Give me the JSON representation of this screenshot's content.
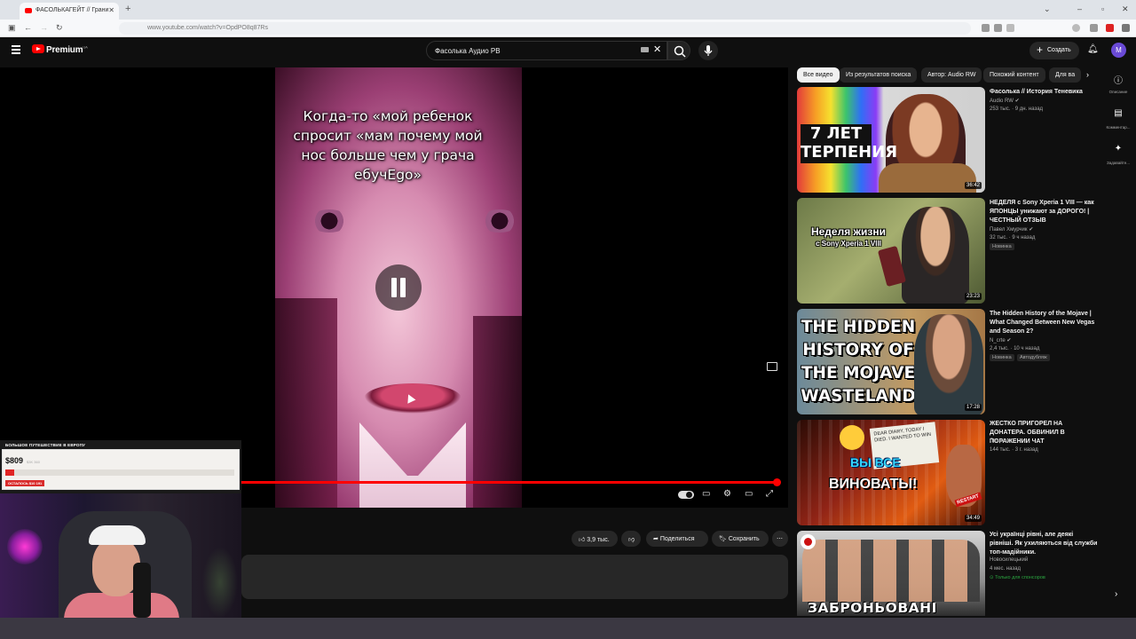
{
  "browser": {
    "tab_title": "ФАСОЛЬКАГЕЙТ // Грани",
    "url": "www.youtube.com/watch?v=OpdPO8q87Rs"
  },
  "header": {
    "logo": "Premium",
    "region": "UA",
    "search_value": "Фасолька Аудио РВ",
    "create_label": "Создать",
    "avatar_letter": "M"
  },
  "player": {
    "caption_lines": [
      "Когда-то «мой ребенок",
      "спросит «мам почему мой",
      "нос больше чем у грача",
      "ебучEgo»"
    ],
    "progress_percent": 99
  },
  "actions": {
    "likes": "3,9 тыс.",
    "share": "Поделиться",
    "save": "Сохранить"
  },
  "overlay": {
    "goal_title": "БОЛЬШОЕ ПУТЕШЕСТВИЕ В ЕВРОПУ",
    "goal_amount": "$809",
    "goal_target": "$3K 360",
    "goal_note": "ОСТАЛОСЬ $10 191",
    "goal_percent": 4
  },
  "chips": [
    "Все видео",
    "Из результатов поиска",
    "Автор: Audio RW",
    "Похожий контент",
    "Для ва"
  ],
  "side_panel": [
    {
      "icon": "info-icon",
      "label": "Описание"
    },
    {
      "icon": "comments-icon",
      "label": "Комментар..."
    },
    {
      "icon": "sparkle-icon",
      "label": "Задавайте..."
    }
  ],
  "videos": [
    {
      "title": "Фасолька // История Теневика",
      "channel": "Audio RW",
      "meta": "253 тыс. · 9 дн. назад",
      "duration": "36:42",
      "thumb_text": "7 ЛЕТ ТЕРПЕНИЯ"
    },
    {
      "title": "НЕДЕЛЯ с Sony Xperia 1 VIII — как ЯПОНЦЫ унижают за ДОРОГО! | ЧЕСТНЫЙ ОТЗЫВ",
      "channel": "Павел Хмурчик",
      "meta": "32 тыс. · 9 ч назад",
      "badge": "Новинка",
      "duration": "23:23",
      "thumb_text": "Неделя жизни",
      "thumb_text2": "с Sony Xperia 1 VIII"
    },
    {
      "title": "The Hidden History of the Mojave | What Changed Between New Vegas and Season 2?",
      "channel": "N_crte",
      "meta": "2,4 тыс. · 10 ч назад",
      "badge": "Новинка",
      "badge2": "Автодубляж",
      "duration": "17:28",
      "thumb_text": "THE HIDDEN HISTORY OF THE MOJAVE WASTELAND"
    },
    {
      "title": "ЖЕСТКО ПРИГОРЕЛ НА ДОНАТЕРА. ОБВИНИЛ В ПОРАЖЕНИИ ЧАТ",
      "channel": "Лещина",
      "meta": "144 тыс. · 3 г. назад",
      "duration": "34:49",
      "thumb_text": "ВЫ ВСЕ",
      "thumb_text2": "ВИНОВАТЫ!",
      "paper_text": "DEAR DIARY, TODAY I DIED. I WANTED TO WIN",
      "sticker": "RESTART"
    },
    {
      "title": "Усі українці рівні, але деякі рівніші. Як ухиляються від служби топ-мадійники.",
      "channel": "Новосилецький",
      "meta": "4 мес. назад",
      "sponsor": "Только для спонсоров",
      "thumb_text": "ЗАБРОНЬОВАНІ"
    }
  ]
}
